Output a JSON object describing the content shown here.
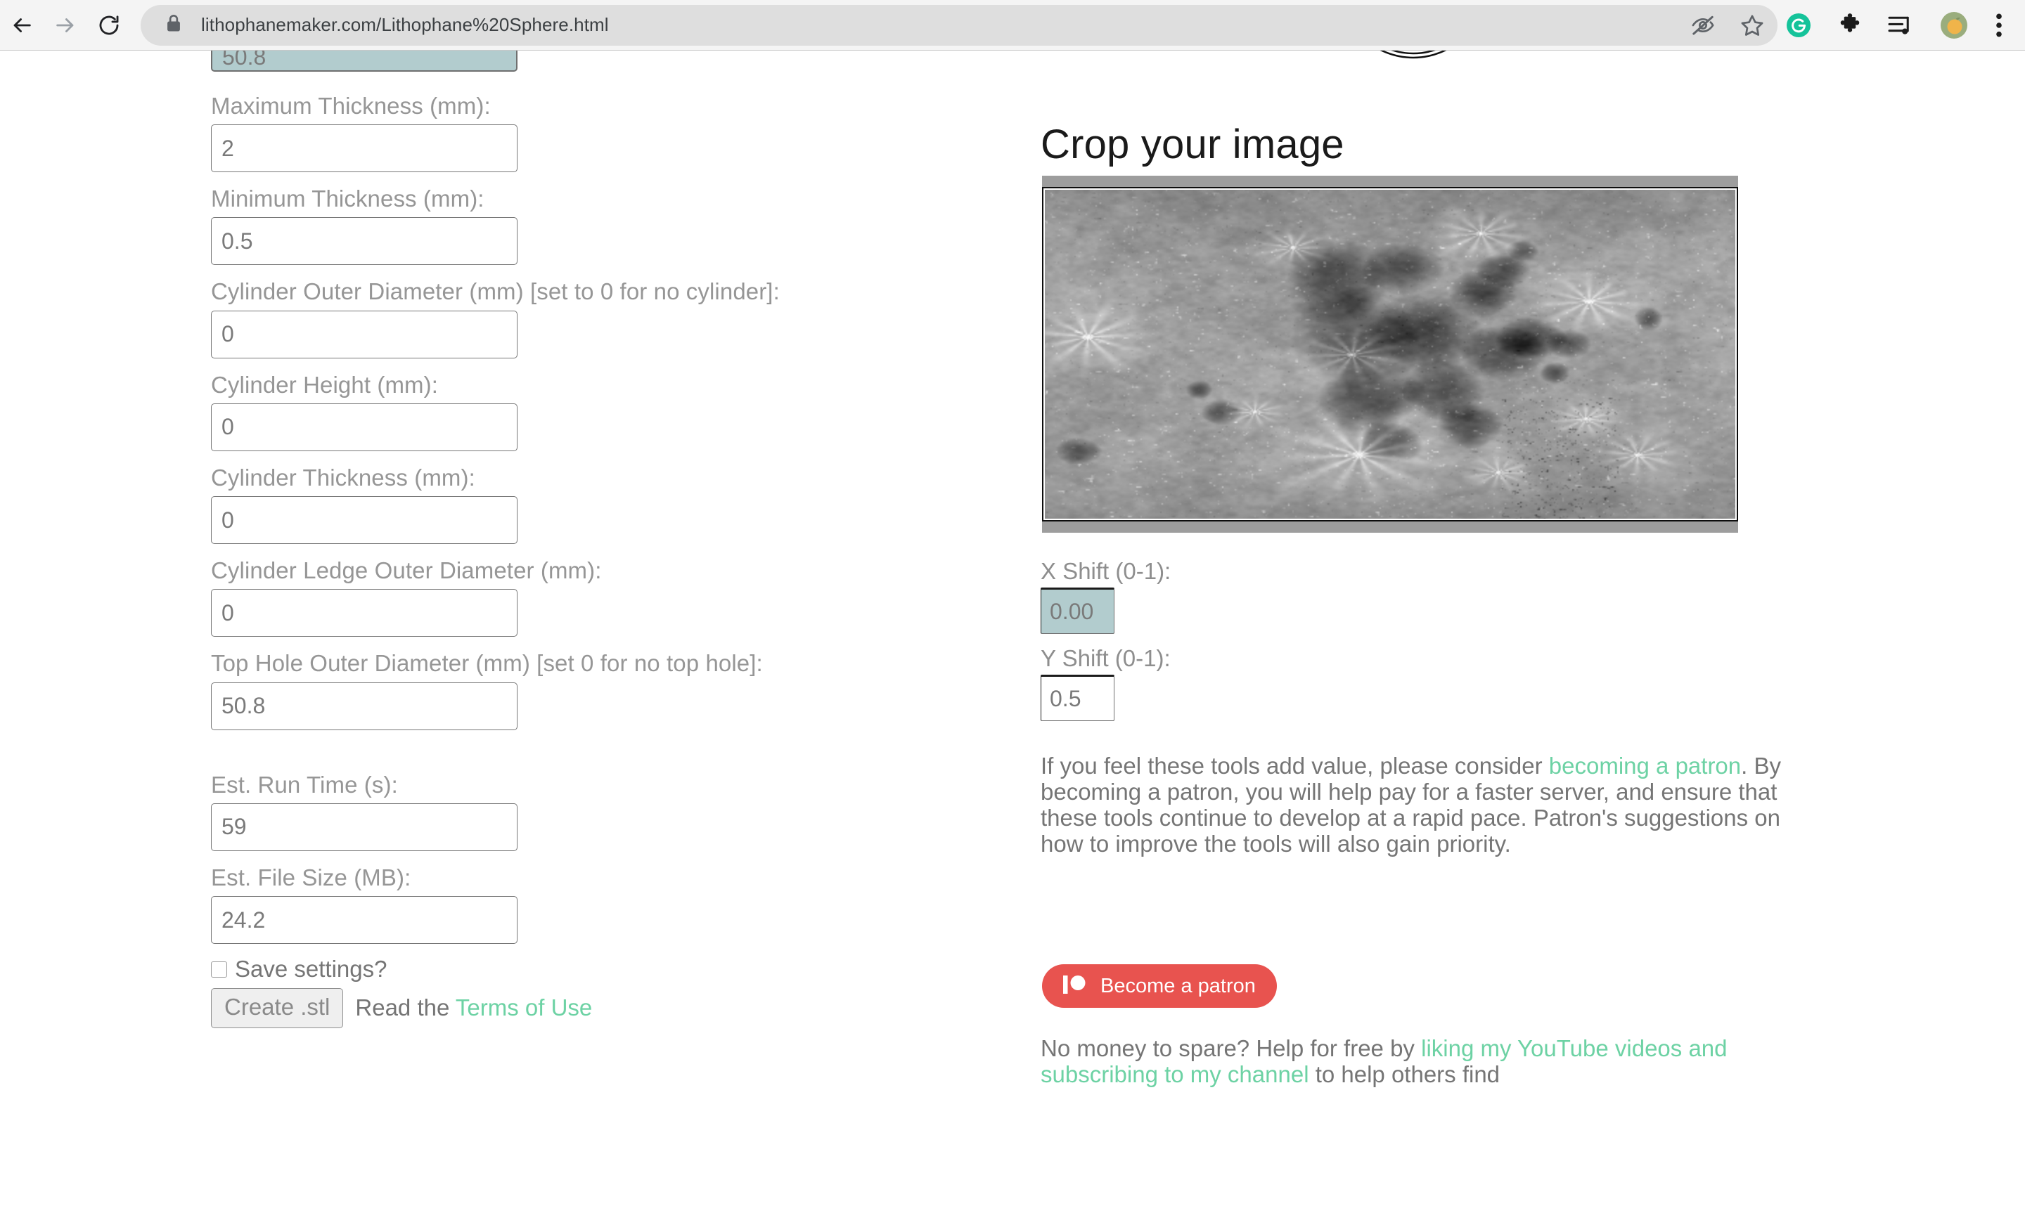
{
  "browser": {
    "back_icon": "back-arrow-icon",
    "forward_icon": "forward-arrow-icon",
    "reload_icon": "reload-icon",
    "lock_icon": "lock-icon",
    "url": "lithophanemaker.com/Lithophane%20Sphere.html",
    "actions": [
      {
        "name": "hidden-eye-icon",
        "label": ""
      },
      {
        "name": "bookmark-star-icon",
        "label": ""
      },
      {
        "name": "grammarly-extension-icon",
        "label": "G"
      },
      {
        "name": "extensions-puzzle-icon",
        "label": ""
      },
      {
        "name": "media-playlist-icon",
        "label": ""
      },
      {
        "name": "profile-avatar-icon",
        "label": ""
      },
      {
        "name": "chrome-menu-icon",
        "label": ""
      }
    ],
    "accent_green": "#1fc48b",
    "avatar_bg": "#9aad7d",
    "avatar_fg": "#f0b44a"
  },
  "form": {
    "clipped_field_value": "50.8",
    "fields": [
      {
        "label": "Maximum Thickness (mm):",
        "value": "2"
      },
      {
        "label": "Minimum Thickness (mm):",
        "value": "0.5"
      },
      {
        "label": "Cylinder Outer Diameter (mm) [set to 0 for no cylinder]:",
        "value": "0"
      },
      {
        "label": "Cylinder Height (mm):",
        "value": "0"
      },
      {
        "label": "Cylinder Thickness (mm):",
        "value": "0"
      },
      {
        "label": "Cylinder Ledge Outer Diameter (mm):",
        "value": "0"
      },
      {
        "label": "Top Hole Outer Diameter (mm) [set 0 for no top hole]:",
        "value": "50.8"
      }
    ],
    "estimates": [
      {
        "label": "Est. Run Time (s):",
        "value": "59"
      },
      {
        "label": "Est. File Size (MB):",
        "value": "24.2"
      }
    ],
    "save_settings_label": "Save settings?",
    "save_settings_checked": false,
    "create_button_label": "Create .stl",
    "read_the_text": "Read the ",
    "terms_link_label": "Terms of Use"
  },
  "crop": {
    "heading": "Crop your image",
    "image_alt": "grayscale-lunar-surface-map",
    "x_shift_label": "X Shift (0-1):",
    "x_shift_value": "0.00",
    "x_shift_selected": true,
    "y_shift_label": "Y Shift (0-1):",
    "y_shift_value": "0.5",
    "selection_color": "#b2ccce"
  },
  "patron": {
    "paragraph_part1": "If you feel these tools add value, please consider ",
    "link_label": "becoming a patron",
    "paragraph_part2": ". By becoming a patron, you will help pay for a faster server, and ensure that these tools continue to develop at a rapid pace. Patron's suggestions on how to improve the tools will also gain priority.",
    "button_label": "Become a patron",
    "button_color": "#e8534f",
    "free_help_part1": "No money to spare? Help for free by ",
    "free_help_link": "liking my YouTube videos and subscribing to my channel",
    "free_help_part2": " to help others find",
    "link_color": "#6dd2a4"
  }
}
